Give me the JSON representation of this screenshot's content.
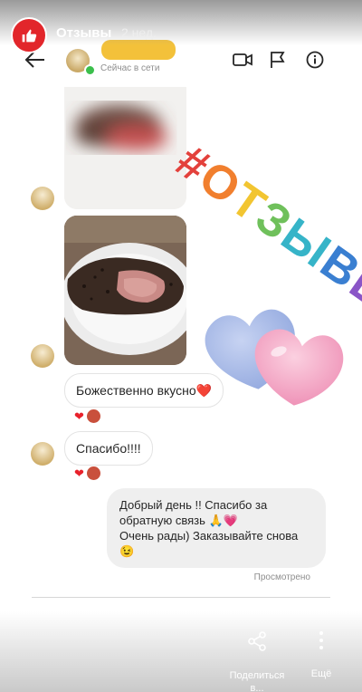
{
  "story": {
    "title": "Отзывы",
    "time": "2 нед."
  },
  "chat_header": {
    "status": "Сейчас в сети",
    "icons": [
      "back-arrow-icon",
      "video-call-icon",
      "flag-icon",
      "info-icon"
    ]
  },
  "sticker": {
    "hashtag": [
      "#",
      "О",
      "Т",
      "З",
      "Ы",
      "В",
      "Ы"
    ],
    "colors": [
      "#e3413c",
      "#f17f2e",
      "#f2c531",
      "#6fc05b",
      "#36b4c8",
      "#3a7fd1",
      "#8a55c7"
    ]
  },
  "messages": {
    "msg1": "Божественно вкусно❤️",
    "msg2": "Спасибо!!!!",
    "reply_line1": "Добрый день !! Спасибо за",
    "reply_line2": "обратную связь 🙏💗",
    "reply_line3": "Очень рады) Заказывайте снова",
    "reply_line4": "😉",
    "reactions": [
      "❤",
      "😋"
    ],
    "seen": "Просмотрено"
  },
  "bottom_bar": {
    "share_label": "Поделиться в...",
    "more_label": "Ещё"
  }
}
